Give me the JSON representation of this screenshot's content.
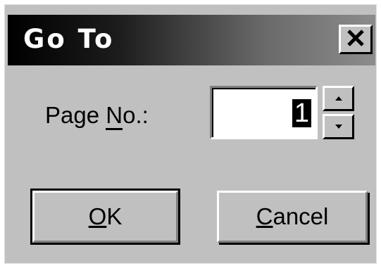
{
  "dialog": {
    "title": "Go To",
    "close_icon": "close-icon",
    "page_label": "Page No.:",
    "page_label_prefix": "Page ",
    "page_label_mnemonic": "N",
    "page_label_suffix": "o.:",
    "page_value": "1",
    "spin_up_icon": "arrow-up-icon",
    "spin_down_icon": "arrow-down-icon",
    "ok_label": "OK",
    "cancel_label": "Cancel"
  },
  "colors": {
    "dialog_bg": "#c0c0c0",
    "titlebar_start": "#000000",
    "titlebar_end": "#8c8c8c",
    "title_text": "#ffffff"
  }
}
